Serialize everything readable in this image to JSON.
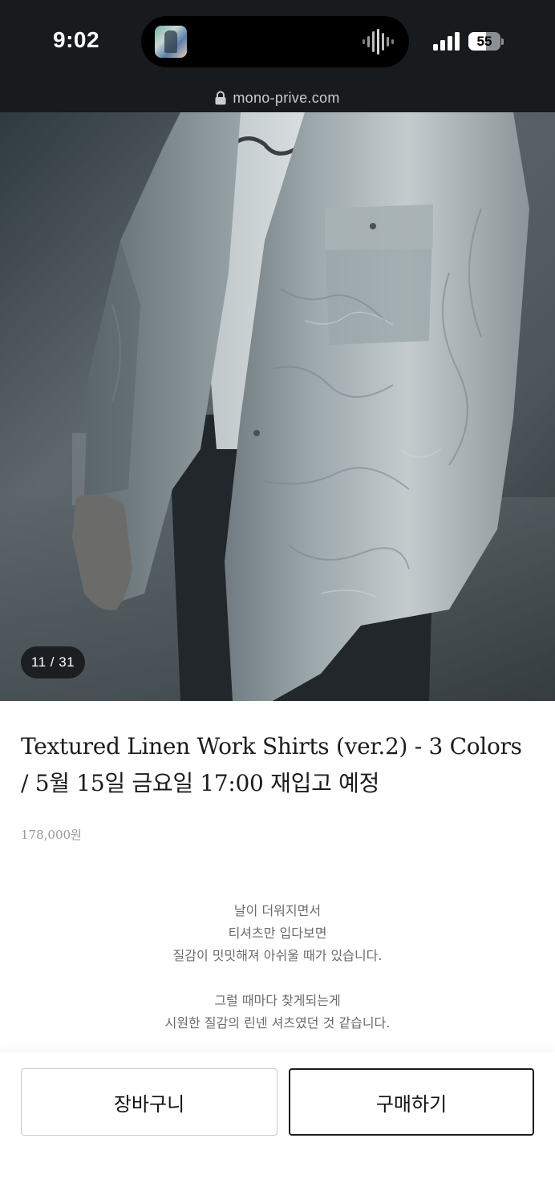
{
  "status_bar": {
    "time": "9:02",
    "battery_level": "55",
    "battery_fraction": 0.55,
    "icons": [
      "now-playing-thumbnail",
      "waveform-icon",
      "signal-icon",
      "battery-icon"
    ]
  },
  "browser": {
    "url": "mono-prive.com",
    "lock_icon": "lock-icon"
  },
  "gallery": {
    "counter": "11 / 31",
    "current_index": 11,
    "total": 31
  },
  "product": {
    "title_line1": "Textured Linen Work Shirts (ver.2) - 3 Colors",
    "title_line2": "/ 5월 15일 금요일 17:00 재입고 예정",
    "price": "178,000원"
  },
  "description": {
    "paragraph1": [
      "날이 더워지면서",
      "티셔츠만 입다보면",
      "질감이 밋밋해져 아쉬울 때가 있습니다."
    ],
    "paragraph2": [
      "그럴 때마다 찾게되는게",
      "시원한 질감의 린넨 셔츠였던 것 같습니다."
    ]
  },
  "actions": {
    "cart_label": "장바구니",
    "buy_label": "구매하기"
  },
  "colors": {
    "status_bg": "#171b1d",
    "text_primary": "#1c1c1c",
    "price_gray": "#9a9a9a",
    "description_gray": "#6b6b6b"
  }
}
